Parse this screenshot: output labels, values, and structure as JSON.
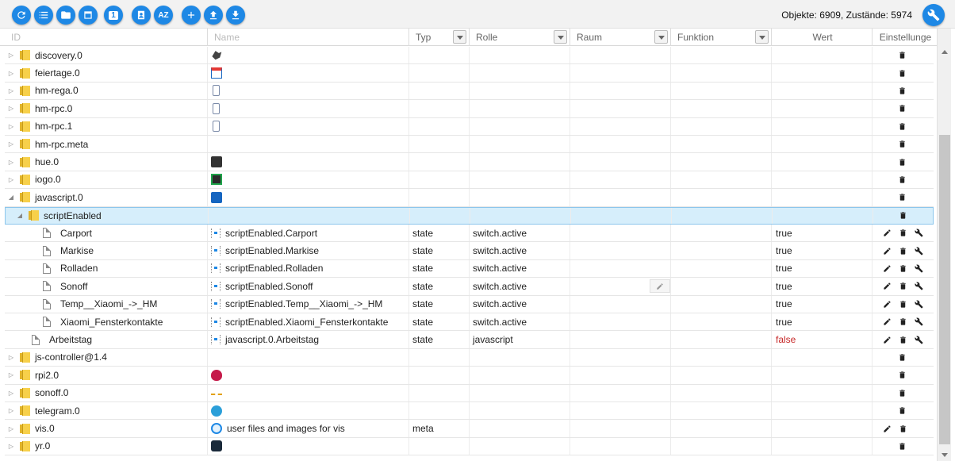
{
  "toolbar": {
    "buttons": [
      {
        "name": "refresh-button",
        "icon": "refresh-icon",
        "label": ""
      },
      {
        "name": "list-view-button",
        "icon": "list-icon",
        "label": ""
      },
      {
        "name": "folder-view-button",
        "icon": "folder-icon",
        "label": ""
      },
      {
        "name": "window-view-button",
        "icon": "window-icon",
        "label": ""
      },
      {
        "name": "level-one-button",
        "icon": "number-icon",
        "label": "1"
      },
      {
        "name": "contacts-button",
        "icon": "contact-icon",
        "label": ""
      },
      {
        "name": "sort-az-button",
        "icon": "sort-az-icon",
        "label": "AZ"
      },
      {
        "name": "add-button",
        "icon": "plus-icon",
        "label": ""
      },
      {
        "name": "upload-button",
        "icon": "upload-icon",
        "label": ""
      },
      {
        "name": "download-button",
        "icon": "download-icon",
        "label": ""
      }
    ],
    "counts": "Objekte: 6909, Zustände: 5974",
    "settings_icon": "wrench-icon",
    "accent": "#1e88e5"
  },
  "header": {
    "id": "ID",
    "name": "Name",
    "typ": "Typ",
    "rolle": "Rolle",
    "raum": "Raum",
    "funktion": "Funktion",
    "wert": "Wert",
    "einstellungen": "Einstellunge"
  },
  "rows": [
    {
      "id": "discovery.0",
      "kind": "folder",
      "level": 0,
      "icon": "bird-icon",
      "name": "",
      "typ": "",
      "rolle": "",
      "wert": "",
      "actions": [
        "delete"
      ]
    },
    {
      "id": "feiertage.0",
      "kind": "folder",
      "level": 0,
      "icon": "calendar-icon",
      "name": "",
      "typ": "",
      "rolle": "",
      "wert": "",
      "actions": [
        "delete"
      ]
    },
    {
      "id": "hm-rega.0",
      "kind": "folder",
      "level": 0,
      "icon": "device-icon",
      "name": "",
      "typ": "",
      "rolle": "",
      "wert": "",
      "actions": [
        "delete"
      ]
    },
    {
      "id": "hm-rpc.0",
      "kind": "folder",
      "level": 0,
      "icon": "device-icon",
      "name": "",
      "typ": "",
      "rolle": "",
      "wert": "",
      "actions": [
        "delete"
      ]
    },
    {
      "id": "hm-rpc.1",
      "kind": "folder",
      "level": 0,
      "icon": "device-icon",
      "name": "",
      "typ": "",
      "rolle": "",
      "wert": "",
      "actions": [
        "delete"
      ]
    },
    {
      "id": "hm-rpc.meta",
      "kind": "folder",
      "level": 0,
      "icon": "",
      "name": "",
      "typ": "",
      "rolle": "",
      "wert": "",
      "actions": [
        "delete"
      ]
    },
    {
      "id": "hue.0",
      "kind": "folder",
      "level": 0,
      "icon": "hue-icon",
      "name": "",
      "typ": "",
      "rolle": "",
      "wert": "",
      "actions": [
        "delete"
      ]
    },
    {
      "id": "iogo.0",
      "kind": "folder",
      "level": 0,
      "icon": "iogo-icon",
      "name": "",
      "typ": "",
      "rolle": "",
      "wert": "",
      "actions": [
        "delete"
      ]
    },
    {
      "id": "javascript.0",
      "kind": "folder",
      "level": 0,
      "expanded": true,
      "icon": "javascript-icon",
      "name": "",
      "typ": "",
      "rolle": "",
      "wert": "",
      "actions": [
        "delete"
      ]
    },
    {
      "id": "scriptEnabled",
      "kind": "folder",
      "level": 1,
      "expanded": true,
      "selected": true,
      "icon": "",
      "name": "",
      "typ": "",
      "rolle": "",
      "wert": "",
      "actions": [
        "delete"
      ]
    },
    {
      "id": "Carport",
      "kind": "state",
      "level": 2,
      "icon": "state-icon",
      "name": "scriptEnabled.Carport",
      "typ": "state",
      "rolle": "switch.active",
      "wert": "true",
      "actions": [
        "edit",
        "delete",
        "settings"
      ]
    },
    {
      "id": "Markise",
      "kind": "state",
      "level": 2,
      "icon": "state-icon",
      "name": "scriptEnabled.Markise",
      "typ": "state",
      "rolle": "switch.active",
      "wert": "true",
      "actions": [
        "edit",
        "delete",
        "settings"
      ]
    },
    {
      "id": "Rolladen",
      "kind": "state",
      "level": 2,
      "icon": "state-icon",
      "name": "scriptEnabled.Rolladen",
      "typ": "state",
      "rolle": "switch.active",
      "wert": "true",
      "actions": [
        "edit",
        "delete",
        "settings"
      ]
    },
    {
      "id": "Sonoff",
      "kind": "state",
      "level": 2,
      "icon": "state-icon",
      "name": "scriptEnabled.Sonoff",
      "typ": "state",
      "rolle": "switch.active",
      "wert": "true",
      "raum_edit": true,
      "actions": [
        "edit",
        "delete",
        "settings"
      ]
    },
    {
      "id": "Temp__Xiaomi_->_HM",
      "kind": "state",
      "level": 2,
      "icon": "state-icon",
      "name": "scriptEnabled.Temp__Xiaomi_->_HM",
      "typ": "state",
      "rolle": "switch.active",
      "wert": "true",
      "actions": [
        "edit",
        "delete",
        "settings"
      ]
    },
    {
      "id": "Xiaomi_Fensterkontakte",
      "kind": "state",
      "level": 2,
      "icon": "state-icon",
      "name": "scriptEnabled.Xiaomi_Fensterkontakte",
      "typ": "state",
      "rolle": "switch.active",
      "wert": "true",
      "actions": [
        "edit",
        "delete",
        "settings"
      ]
    },
    {
      "id": "Arbeitstag",
      "kind": "state",
      "level": 1,
      "icon": "state-icon",
      "name": "javascript.0.Arbeitstag",
      "typ": "state",
      "rolle": "javascript",
      "wert": "false",
      "actions": [
        "edit",
        "delete",
        "settings"
      ]
    },
    {
      "id": "js-controller@1.4",
      "kind": "folder",
      "level": 0,
      "icon": "",
      "name": "",
      "typ": "",
      "rolle": "",
      "wert": "",
      "actions": [
        "delete"
      ]
    },
    {
      "id": "rpi2.0",
      "kind": "folder",
      "level": 0,
      "icon": "raspberry-icon",
      "name": "",
      "typ": "",
      "rolle": "",
      "wert": "",
      "actions": [
        "delete"
      ]
    },
    {
      "id": "sonoff.0",
      "kind": "folder",
      "level": 0,
      "icon": "sonoff-icon",
      "name": "",
      "typ": "",
      "rolle": "",
      "wert": "",
      "actions": [
        "delete"
      ]
    },
    {
      "id": "telegram.0",
      "kind": "folder",
      "level": 0,
      "icon": "telegram-icon",
      "name": "",
      "typ": "",
      "rolle": "",
      "wert": "",
      "actions": [
        "delete"
      ]
    },
    {
      "id": "vis.0",
      "kind": "folder",
      "level": 0,
      "icon": "vis-icon",
      "name": "user files and images for vis",
      "typ": "meta",
      "rolle": "",
      "wert": "",
      "actions": [
        "edit",
        "delete"
      ]
    },
    {
      "id": "yr.0",
      "kind": "folder",
      "level": 0,
      "icon": "yr-icon",
      "name": "",
      "typ": "",
      "rolle": "",
      "wert": "",
      "actions": [
        "delete"
      ]
    }
  ]
}
